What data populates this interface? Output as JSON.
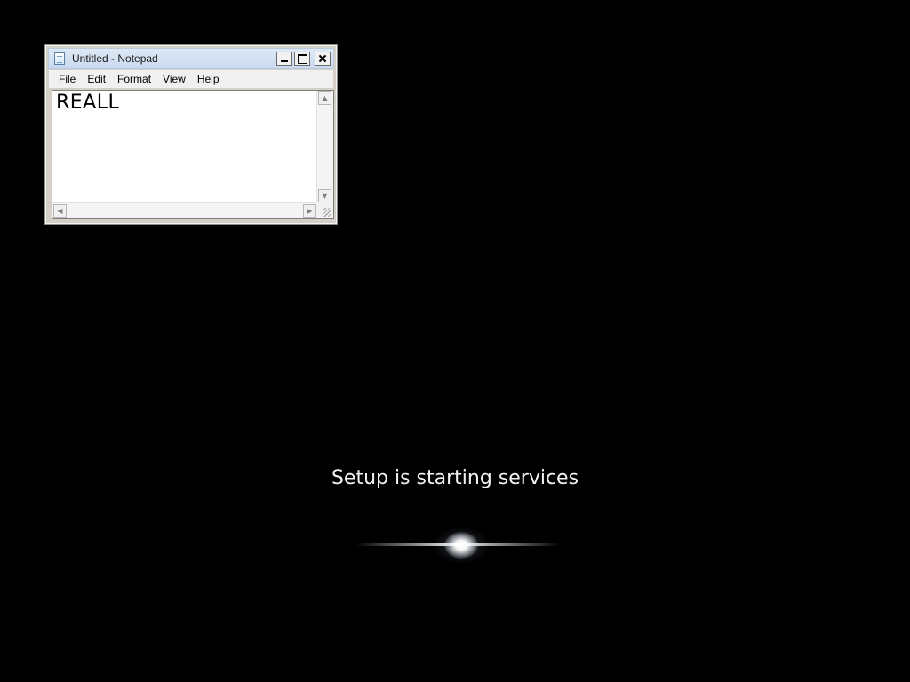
{
  "desktop": {
    "background_color": "#000000"
  },
  "notepad": {
    "title": "Untitled - Notepad",
    "icon": "notepad-icon",
    "menu": [
      {
        "label": "File"
      },
      {
        "label": "Edit"
      },
      {
        "label": "Format"
      },
      {
        "label": "View"
      },
      {
        "label": "Help"
      }
    ],
    "content": "REALL",
    "controls": {
      "minimize": "minimize-icon",
      "maximize": "maximize-icon",
      "close": "close-icon"
    }
  },
  "setup": {
    "status_text": "Setup is starting services",
    "progress_indicator": "glow-animation-icon",
    "text_color": "#f2f2f2"
  }
}
